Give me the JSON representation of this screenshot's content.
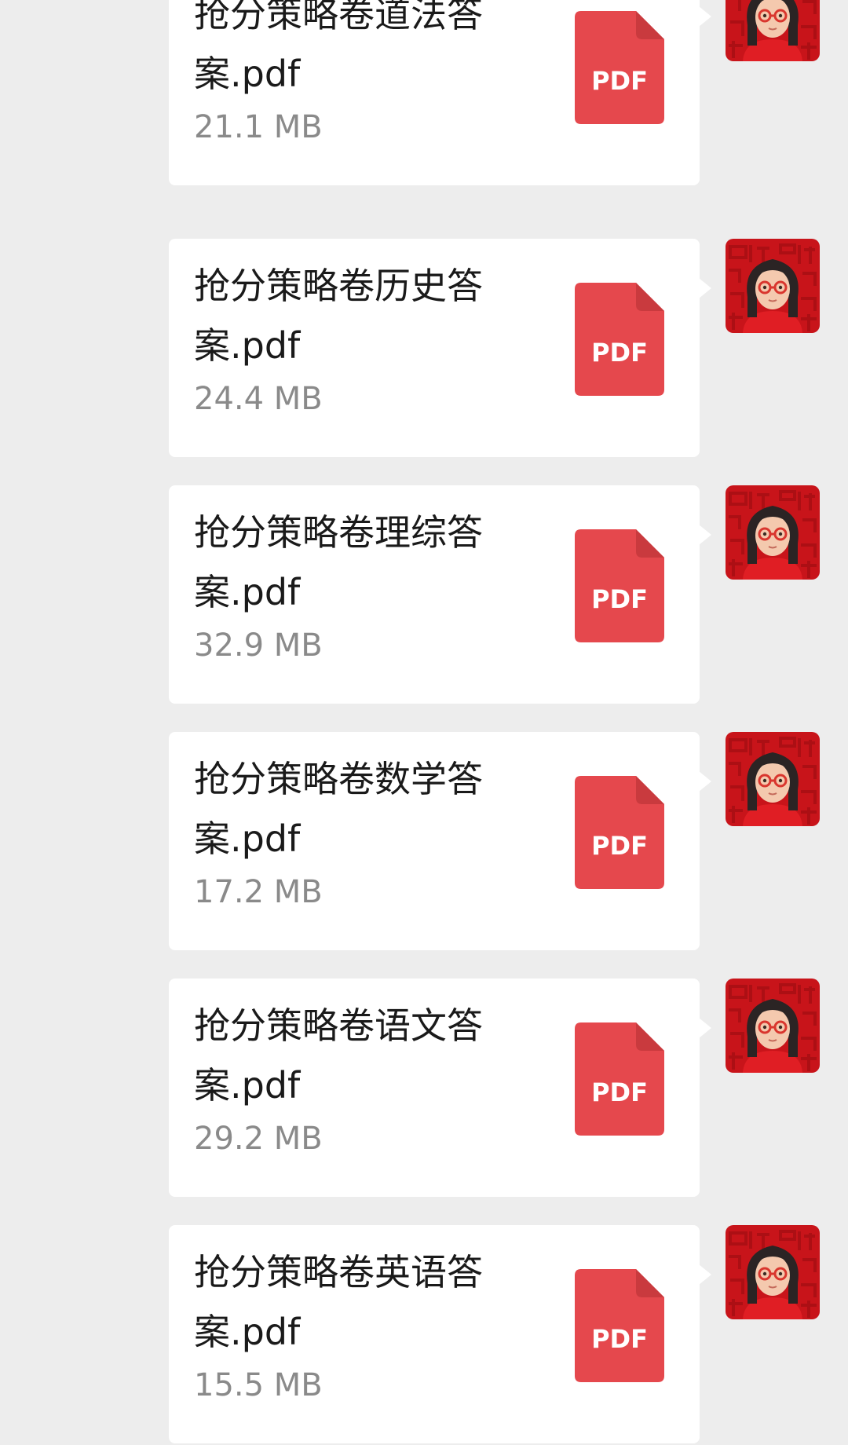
{
  "chat": {
    "messages": [
      {
        "file_name": "抢分策略卷道法答案.pdf",
        "file_size": "21.1 MB",
        "file_type": "PDF"
      },
      {
        "file_name": "抢分策略卷历史答案.pdf",
        "file_size": "24.4 MB",
        "file_type": "PDF"
      },
      {
        "file_name": "抢分策略卷理综答案.pdf",
        "file_size": "32.9 MB",
        "file_type": "PDF"
      },
      {
        "file_name": "抢分策略卷数学答案.pdf",
        "file_size": "17.2 MB",
        "file_type": "PDF"
      },
      {
        "file_name": "抢分策略卷语文答案.pdf",
        "file_size": "29.2 MB",
        "file_type": "PDF"
      },
      {
        "file_name": "抢分策略卷英语答案.pdf",
        "file_size": "15.5 MB",
        "file_type": "PDF"
      }
    ]
  },
  "icons": {
    "file": "pdf-file-icon",
    "avatar": "user-avatar"
  },
  "colors": {
    "background": "#ededed",
    "bubble": "#ffffff",
    "pdf_red": "#e5484d",
    "pdf_fold": "#c93a3e",
    "file_name_text": "#1a1a1a",
    "file_size_text": "#8a8a8a",
    "avatar_bg": "#c8141a"
  }
}
